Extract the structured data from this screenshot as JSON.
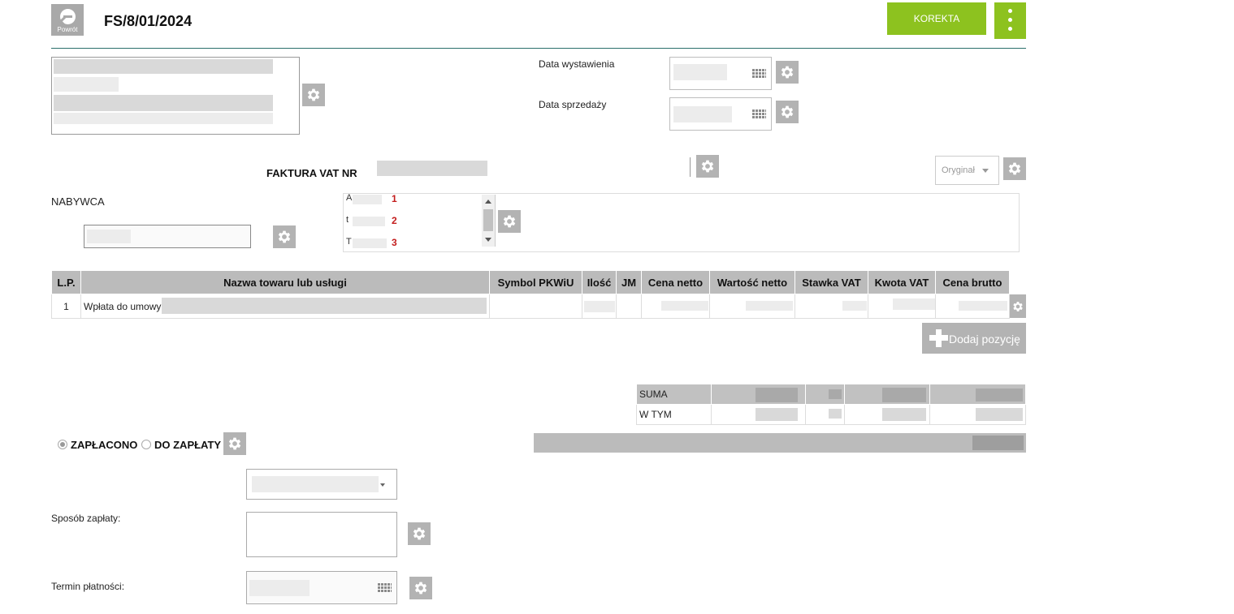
{
  "header": {
    "back_label": "Powrót",
    "title": "FS/8/01/2024",
    "korekta_label": "KOREKTA"
  },
  "dates": {
    "issue_label": "Data wystawienia",
    "sale_label": "Data sprzedaży"
  },
  "invoice": {
    "number_label": "FAKTURA VAT NR",
    "copy_type": "Oryginał"
  },
  "buyer": {
    "label": "NABYWCA",
    "addresses": [
      {
        "prefix": "A",
        "num": "1"
      },
      {
        "prefix": "t",
        "num": "2"
      },
      {
        "prefix": "T",
        "num": "3"
      }
    ]
  },
  "items_table": {
    "columns": [
      "L.P.",
      "Nazwa towaru lub usługi",
      "Symbol PKWiU",
      "Ilość",
      "JM",
      "Cena netto",
      "Wartość netto",
      "Stawka VAT",
      "Kwota VAT",
      "Cena brutto"
    ],
    "rows": [
      {
        "lp": "1",
        "name": "Wpłata do umowy"
      }
    ],
    "add_label": "Dodaj pozycję"
  },
  "summary": {
    "sum_label": "SUMA",
    "wtym_label": "W TYM"
  },
  "payment": {
    "paid_label": "ZAPŁACONO",
    "due_label": "DO ZAPŁATY",
    "paid_selected": true,
    "method_label": "Sposób zapłaty:",
    "term_label": "Termin płatności:"
  },
  "colors": {
    "accent": "#8dc21f",
    "divider": "#2a6f6b",
    "gear_bg": "#b3b3b3"
  }
}
